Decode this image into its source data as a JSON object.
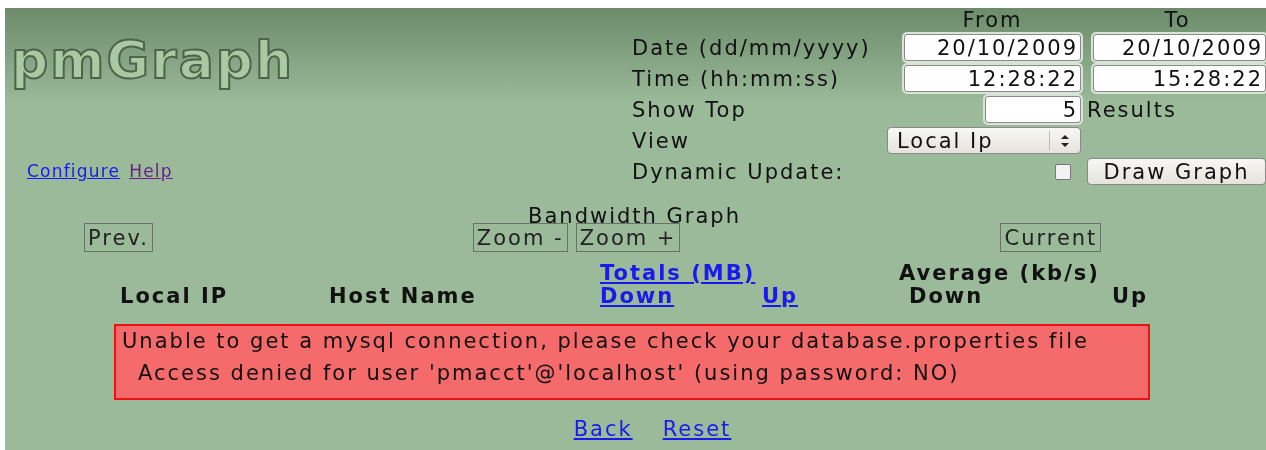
{
  "logo": "pmGraph",
  "links": [
    {
      "label": "Configure",
      "visited": false
    },
    {
      "label": "Help",
      "visited": true
    }
  ],
  "form": {
    "columns": [
      "From",
      "To"
    ],
    "date": {
      "label": "Date (dd/mm/yyyy)",
      "from": "20/10/2009",
      "to": "20/10/2009"
    },
    "time": {
      "label": "Time (hh:mm:ss)",
      "from": "12:28:22",
      "to": "15:28:22"
    },
    "show_top": {
      "label": "Show Top",
      "value": "5",
      "suffix": "Results"
    },
    "view": {
      "label": "View",
      "value": "Local Ip"
    },
    "dynamic_update": {
      "label": "Dynamic Update:",
      "checked": false
    },
    "draw_button": "Draw Graph"
  },
  "graph": {
    "title": "Bandwidth Graph",
    "prev": "Prev.",
    "zoom_out": "Zoom -",
    "zoom_in": "Zoom +",
    "current": "Current"
  },
  "table": {
    "local_ip": "Local IP",
    "host_name": "Host Name",
    "totals": {
      "label": "Totals (MB)",
      "down": "Down",
      "up": "Up"
    },
    "average": {
      "label": "Average (kb/s)",
      "down": "Down",
      "up": "Up"
    }
  },
  "error": [
    "Unable to get a mysql connection, please check your database.properties file",
    "Access denied for user 'pmacct'@'localhost' (using password: NO)"
  ],
  "footer_links": [
    "Back",
    "Reset"
  ]
}
